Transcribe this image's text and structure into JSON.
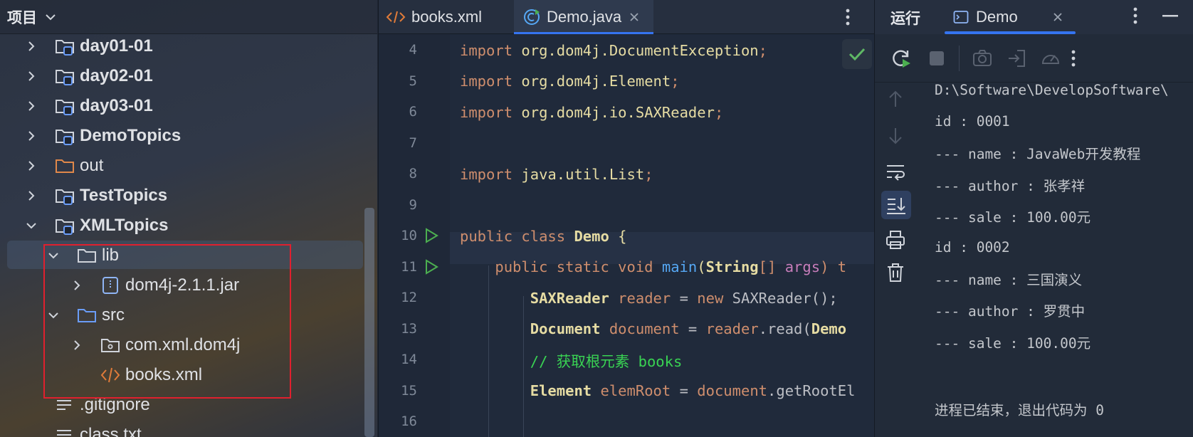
{
  "project": {
    "title": "项目",
    "items": [
      {
        "label": "day01-01",
        "type": "module",
        "expanded": false,
        "bold": true
      },
      {
        "label": "day02-01",
        "type": "module",
        "expanded": false,
        "bold": true
      },
      {
        "label": "day03-01",
        "type": "module",
        "expanded": false,
        "bold": true
      },
      {
        "label": "DemoTopics",
        "type": "module",
        "expanded": false,
        "bold": true
      },
      {
        "label": "out",
        "type": "excluded-folder",
        "expanded": false,
        "bold": false
      },
      {
        "label": "TestTopics",
        "type": "module",
        "expanded": false,
        "bold": true
      },
      {
        "label": "XMLTopics",
        "type": "module",
        "expanded": true,
        "bold": true
      },
      {
        "label": "lib",
        "type": "folder",
        "expanded": true,
        "bold": false
      },
      {
        "label": "dom4j-2.1.1.jar",
        "type": "jar",
        "expanded": false,
        "bold": false
      },
      {
        "label": "src",
        "type": "source-folder",
        "expanded": true,
        "bold": false
      },
      {
        "label": "com.xml.dom4j",
        "type": "package",
        "expanded": false,
        "bold": false
      },
      {
        "label": "books.xml",
        "type": "xml-file",
        "bold": false
      },
      {
        "label": ".gitignore",
        "type": "text-file",
        "bold": false
      },
      {
        "label": "class.txt",
        "type": "text-file",
        "bold": false
      }
    ]
  },
  "editor": {
    "tabs": [
      {
        "label": "books.xml",
        "icon": "xml-file-icon",
        "active": false
      },
      {
        "label": "Demo.java",
        "icon": "java-class-icon",
        "active": true,
        "closable": true
      }
    ],
    "line_numbers": [
      "4",
      "5",
      "6",
      "7",
      "8",
      "9",
      "10",
      "11",
      "12",
      "13",
      "14",
      "15",
      "16"
    ],
    "lines": [
      {
        "n": "4",
        "tokens": [
          {
            "t": "import ",
            "c": "kw"
          },
          {
            "t": "org.dom4j.",
            "c": "pkg"
          },
          {
            "t": "DocumentException",
            "c": "pkg"
          },
          {
            "t": ";",
            "c": "kw"
          }
        ]
      },
      {
        "n": "5",
        "tokens": [
          {
            "t": "import ",
            "c": "kw"
          },
          {
            "t": "org.dom4j.",
            "c": "pkg"
          },
          {
            "t": "Element",
            "c": "pkg"
          },
          {
            "t": ";",
            "c": "kw"
          }
        ]
      },
      {
        "n": "6",
        "tokens": [
          {
            "t": "import ",
            "c": "kw"
          },
          {
            "t": "org.dom4j.io.",
            "c": "pkg"
          },
          {
            "t": "SAXReader",
            "c": "pkg"
          },
          {
            "t": ";",
            "c": "kw"
          }
        ]
      },
      {
        "n": "7",
        "tokens": []
      },
      {
        "n": "8",
        "tokens": [
          {
            "t": "import ",
            "c": "kw"
          },
          {
            "t": "java.util.",
            "c": "pkg"
          },
          {
            "t": "List",
            "c": "pkg"
          },
          {
            "t": ";",
            "c": "kw"
          }
        ]
      },
      {
        "n": "9",
        "tokens": []
      },
      {
        "n": "10",
        "tokens": [
          {
            "t": "public class ",
            "c": "kw"
          },
          {
            "t": "Demo",
            "c": "cls"
          },
          {
            "t": " ",
            "c": "pl"
          },
          {
            "t": "{",
            "c": "br"
          }
        ]
      },
      {
        "n": "11",
        "tokens": [
          {
            "t": "    public static void ",
            "c": "kw"
          },
          {
            "t": "main",
            "c": "fn"
          },
          {
            "t": "(",
            "c": "br"
          },
          {
            "t": "String",
            "c": "cls"
          },
          {
            "t": "[] ",
            "c": "kw"
          },
          {
            "t": "args",
            "c": "par"
          },
          {
            "t": ") t",
            "c": "kw"
          }
        ]
      },
      {
        "n": "12",
        "tokens": [
          {
            "t": "        ",
            "c": "pl"
          },
          {
            "t": "SAXReader",
            "c": "cls"
          },
          {
            "t": " reader",
            "c": "kw"
          },
          {
            "t": " = ",
            "c": "pl"
          },
          {
            "t": "new ",
            "c": "kw"
          },
          {
            "t": "SAXReader();",
            "c": "pl"
          }
        ]
      },
      {
        "n": "13",
        "tokens": [
          {
            "t": "        ",
            "c": "pl"
          },
          {
            "t": "Document",
            "c": "cls"
          },
          {
            "t": " document",
            "c": "kw"
          },
          {
            "t": " = ",
            "c": "pl"
          },
          {
            "t": "reader",
            "c": "kw"
          },
          {
            "t": ".read(",
            "c": "pl"
          },
          {
            "t": "Demo",
            "c": "cls"
          }
        ]
      },
      {
        "n": "14",
        "tokens": [
          {
            "t": "        ",
            "c": "pl"
          },
          {
            "t": "// 获取根元素 books",
            "c": "cmt"
          }
        ]
      },
      {
        "n": "15",
        "tokens": [
          {
            "t": "        ",
            "c": "pl"
          },
          {
            "t": "Element",
            "c": "cls"
          },
          {
            "t": " elemRoot",
            "c": "kw"
          },
          {
            "t": " = ",
            "c": "pl"
          },
          {
            "t": "document",
            "c": "kw"
          },
          {
            "t": ".getRootEl",
            "c": "pl"
          }
        ]
      }
    ]
  },
  "run": {
    "title": "运行",
    "tab_label": "Demo",
    "output": [
      "D:\\Software\\DevelopSoftware\\",
      "id : 0001",
      "--- name : JavaWeb开发教程",
      "--- author : 张孝祥",
      "--- sale : 100.00元",
      "id : 0002",
      "--- name : 三国演义",
      "--- author : 罗贯中",
      "--- sale : 100.00元",
      "",
      "进程已结束，退出代码为 0"
    ]
  },
  "colors": {
    "accent": "#3574f0",
    "highlight_box": "#e0202e",
    "run_green": "#4caf50"
  }
}
